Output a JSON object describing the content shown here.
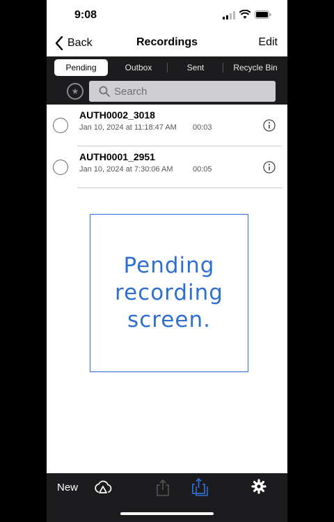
{
  "status_bar": {
    "time": "9:08"
  },
  "nav": {
    "back_label": "Back",
    "title": "Recordings",
    "edit_label": "Edit"
  },
  "tabs": [
    {
      "label": "Pending",
      "active": true
    },
    {
      "label": "Outbox",
      "active": false
    },
    {
      "label": "Sent",
      "active": false
    },
    {
      "label": "Recycle Bin",
      "active": false
    }
  ],
  "search": {
    "placeholder": "Search"
  },
  "recordings": [
    {
      "name": "AUTH0002_3018",
      "date": "Jan 10, 2024 at 11:18:47 AM",
      "duration": "00:03"
    },
    {
      "name": "AUTH0001_2951",
      "date": "Jan 10, 2024 at 7:30:06 AM",
      "duration": "00:05"
    }
  ],
  "placeholder_box": {
    "text": "Pending recording screen."
  },
  "toolbar": {
    "new_label": "New"
  },
  "colors": {
    "accent": "#2f6fd1",
    "bar_background": "#1c1c1e"
  }
}
